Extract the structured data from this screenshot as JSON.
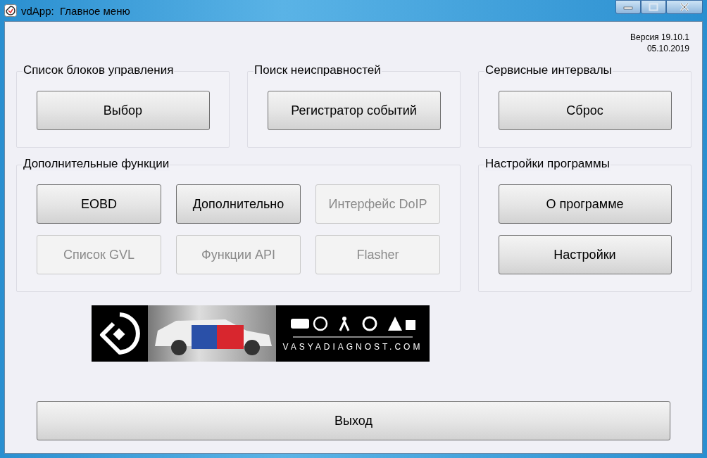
{
  "window": {
    "title": "vdApp:  Главное меню"
  },
  "version": {
    "number": "Версия 19.10.1",
    "date": "05.10.2019"
  },
  "groups": [
    {
      "title": "Список блоков управления",
      "buttons": [
        {
          "label": "Выбор",
          "disabled": false
        }
      ]
    },
    {
      "title": "Поиск неисправностей",
      "buttons": [
        {
          "label": "Регистратор событий",
          "disabled": false
        }
      ]
    },
    {
      "title": "Сервисные интервалы",
      "buttons": [
        {
          "label": "Сброс",
          "disabled": false
        }
      ]
    },
    {
      "title": "Дополнительные функции",
      "buttons": [
        {
          "label": "EOBD",
          "disabled": false
        },
        {
          "label": "Дополнительно",
          "disabled": false
        },
        {
          "label": "Интерфейс DoIP",
          "disabled": true
        },
        {
          "label": "Список GVL",
          "disabled": true
        },
        {
          "label": "Функции API",
          "disabled": true
        },
        {
          "label": "Flasher",
          "disabled": true
        }
      ]
    },
    {
      "title": "Настройки программы",
      "buttons": [
        {
          "label": "О программе",
          "disabled": false
        },
        {
          "label": "Настройки",
          "disabled": false
        }
      ]
    }
  ],
  "banner": {
    "text": "VASYADIAGNOST.COM"
  },
  "exit_button": {
    "label": "Выход"
  }
}
